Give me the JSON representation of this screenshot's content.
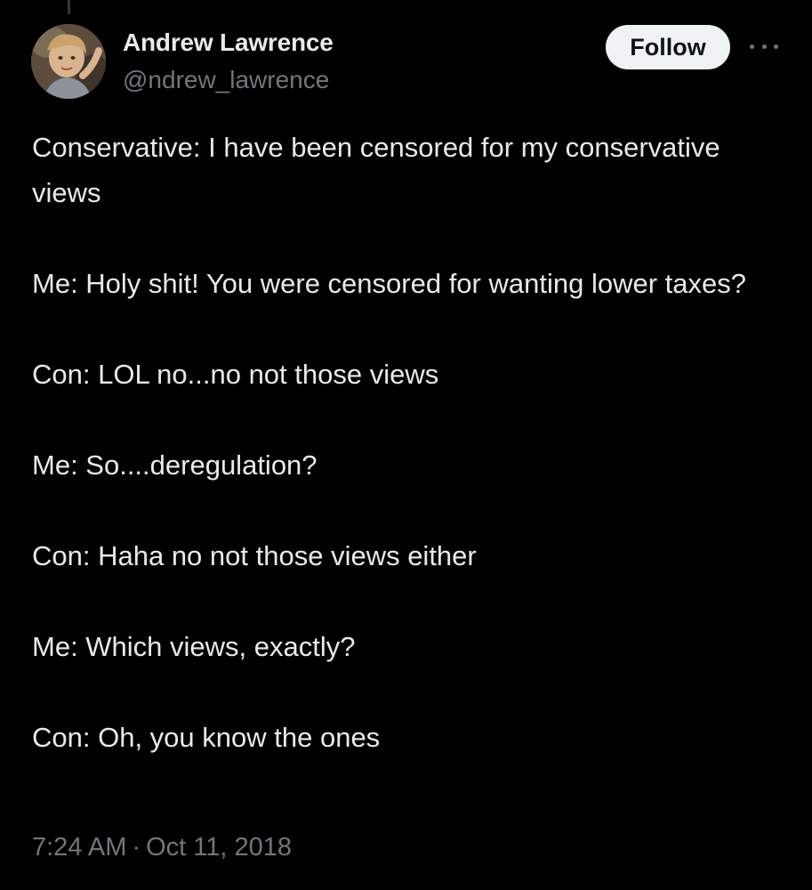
{
  "author": {
    "display_name": "Andrew Lawrence",
    "handle": "@ndrew_lawrence",
    "avatar_icon": "profile-photo-child"
  },
  "actions": {
    "follow_label": "Follow",
    "more_icon": "more-horizontal-icon"
  },
  "tweet": {
    "paragraphs": [
      "Conservative: I have been censored for my conservative views",
      "Me: Holy shit! You were censored for wanting lower taxes?",
      "Con: LOL no...no not those views",
      "Me: So....deregulation?",
      "Con: Haha no not those views either",
      "Me: Which views, exactly?",
      "Con: Oh, you know the ones"
    ],
    "time": "7:24 AM",
    "separator": "·",
    "date": "Oct 11, 2018"
  },
  "colors": {
    "background": "#000000",
    "primary_text": "#e7e9ea",
    "secondary_text": "#71767b",
    "follow_button_bg": "#eff3f4",
    "follow_button_text": "#0f1419"
  }
}
